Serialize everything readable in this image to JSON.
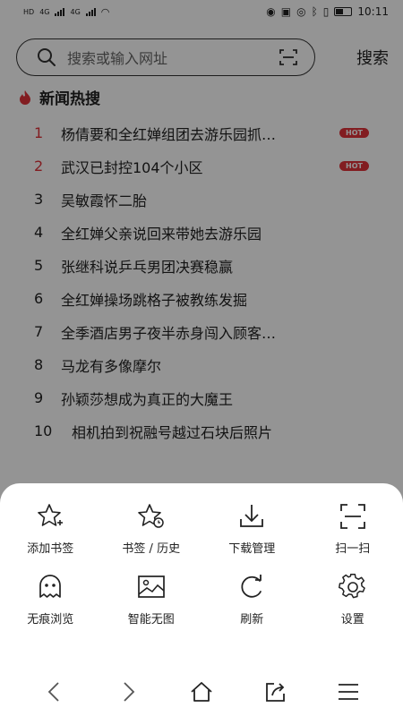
{
  "status_bar": {
    "sim_labels": [
      "HD",
      "HD"
    ],
    "network": [
      "4G",
      "4G"
    ],
    "battery_label": "41",
    "time": "10:11"
  },
  "search": {
    "placeholder": "搜索或输入网址",
    "button_label": "搜索"
  },
  "hot_section": {
    "title": "新闻热搜",
    "items": [
      {
        "rank": "1",
        "title": "杨倩要和全红婵组团去游乐园抓…",
        "badge": "HOT"
      },
      {
        "rank": "2",
        "title": "武汉已封控104个小区",
        "badge": "HOT"
      },
      {
        "rank": "3",
        "title": "吴敏霞怀二胎",
        "badge": ""
      },
      {
        "rank": "4",
        "title": "全红婵父亲说回来带她去游乐园",
        "badge": ""
      },
      {
        "rank": "5",
        "title": "张继科说乒乓男团决赛稳赢",
        "badge": ""
      },
      {
        "rank": "6",
        "title": "全红婵操场跳格子被教练发掘",
        "badge": ""
      },
      {
        "rank": "7",
        "title": "全季酒店男子夜半赤身闯入顾客…",
        "badge": ""
      },
      {
        "rank": "8",
        "title": "马龙有多像摩尔",
        "badge": ""
      },
      {
        "rank": "9",
        "title": "孙颖莎想成为真正的大魔王",
        "badge": ""
      },
      {
        "rank": "10",
        "title": "相机拍到祝融号越过石块后照片",
        "badge": ""
      }
    ]
  },
  "menu": {
    "items": [
      {
        "label": "添加书签",
        "icon": "star-plus-icon"
      },
      {
        "label": "书签 / 历史",
        "icon": "star-clock-icon"
      },
      {
        "label": "下载管理",
        "icon": "download-icon"
      },
      {
        "label": "扫一扫",
        "icon": "scan-icon"
      },
      {
        "label": "无痕浏览",
        "icon": "ghost-icon"
      },
      {
        "label": "智能无图",
        "icon": "image-icon"
      },
      {
        "label": "刷新",
        "icon": "refresh-icon"
      },
      {
        "label": "设置",
        "icon": "gear-icon"
      }
    ]
  },
  "nav": {
    "icons": [
      "back-icon",
      "forward-icon",
      "home-icon",
      "share-icon",
      "menu-icon"
    ]
  },
  "colors": {
    "accent_red": "#e0333a",
    "overlay": "rgba(0,0,0,0.42)"
  }
}
